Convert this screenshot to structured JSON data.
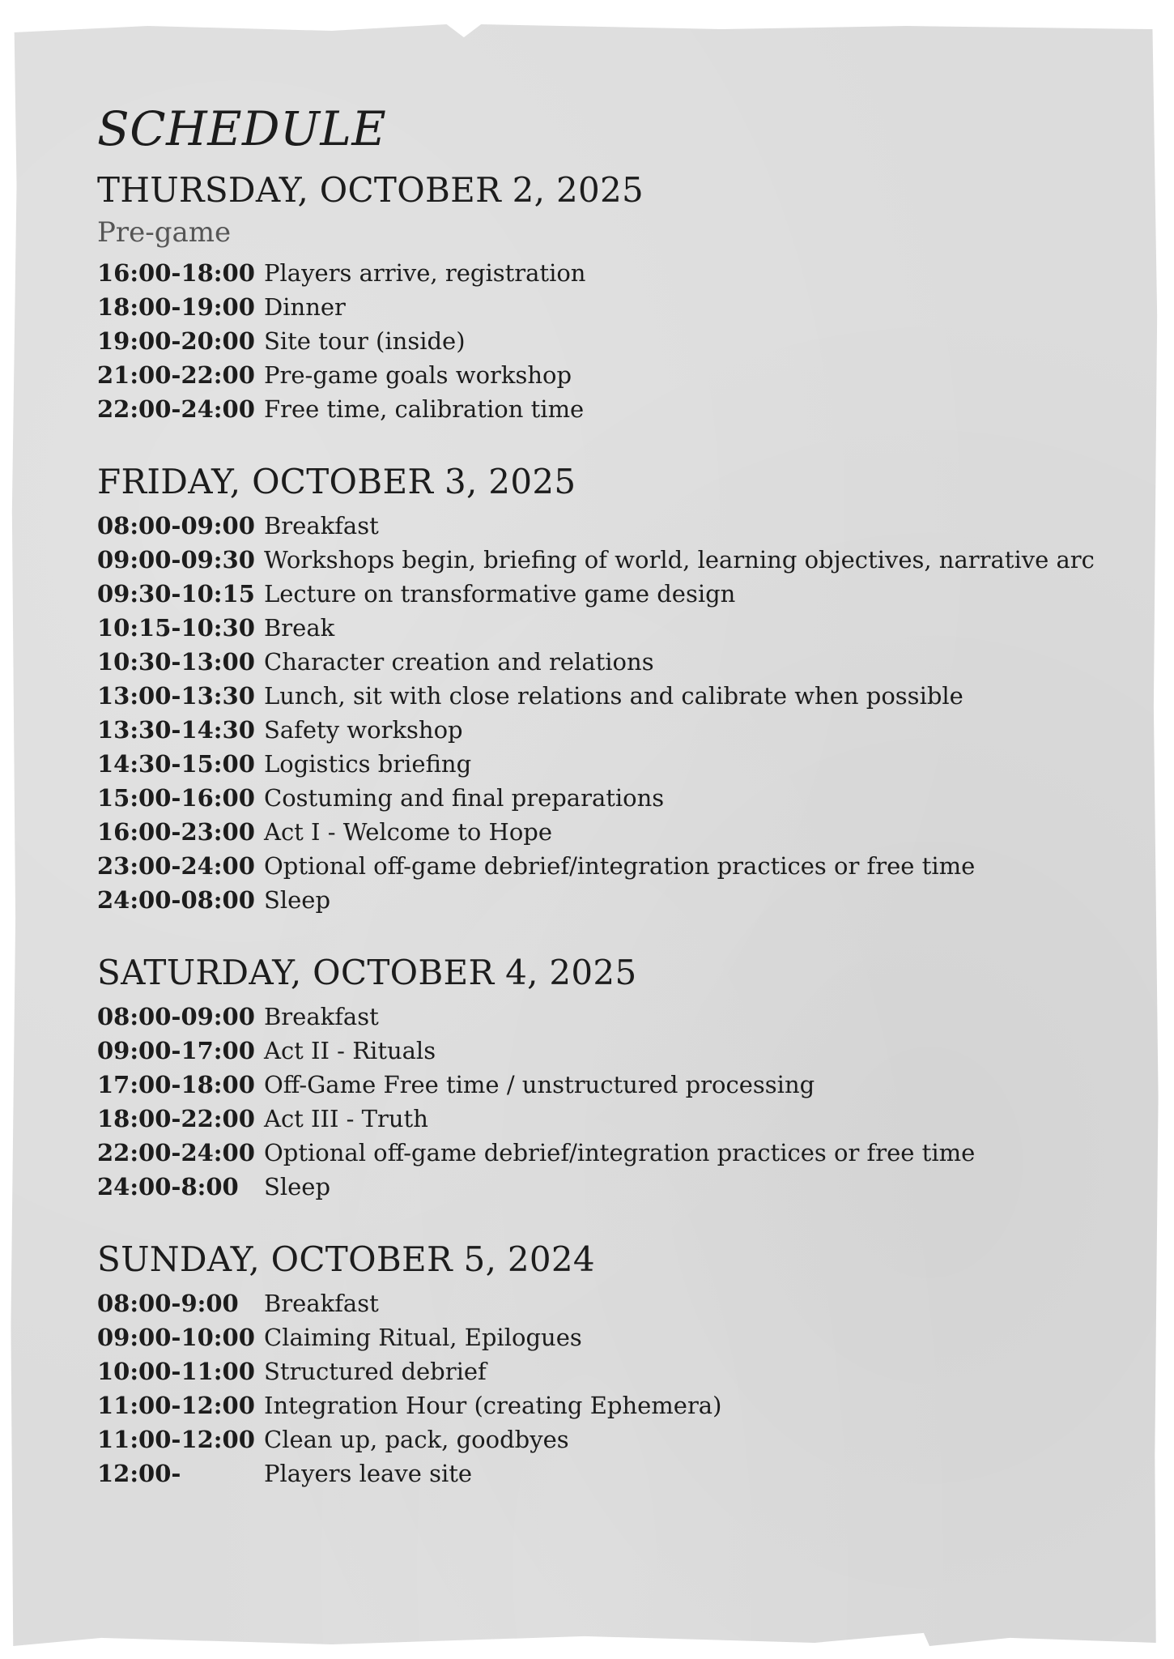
{
  "title": "SCHEDULE",
  "days": [
    {
      "heading": "THURSDAY, OCTOBER 2, 2025",
      "subtitle": "Pre-game",
      "rows": [
        {
          "time": "16:00-18:00",
          "activity": "Players arrive, registration"
        },
        {
          "time": "18:00-19:00",
          "activity": "Dinner"
        },
        {
          "time": "19:00-20:00",
          "activity": "Site tour (inside)"
        },
        {
          "time": "21:00-22:00",
          "activity": "Pre-game goals workshop"
        },
        {
          "time": "22:00-24:00",
          "activity": "Free time, calibration time"
        }
      ]
    },
    {
      "heading": "FRIDAY, OCTOBER 3, 2025",
      "rows": [
        {
          "time": "08:00-09:00",
          "activity": "Breakfast"
        },
        {
          "time": "09:00-09:30",
          "activity": "Workshops begin, briefing of world, learning objectives, narrative arc"
        },
        {
          "time": "09:30-10:15",
          "activity": "Lecture on transformative game design"
        },
        {
          "time": "10:15-10:30",
          "activity": "Break"
        },
        {
          "time": "10:30-13:00",
          "activity": "Character creation and relations"
        },
        {
          "time": "13:00-13:30",
          "activity": "Lunch, sit with close relations and calibrate when possible"
        },
        {
          "time": "13:30-14:30",
          "activity": "Safety workshop"
        },
        {
          "time": "14:30-15:00",
          "activity": "Logistics briefing"
        },
        {
          "time": "15:00-16:00",
          "activity": "Costuming and final preparations"
        },
        {
          "time": "16:00-23:00",
          "activity": "Act I - Welcome to Hope"
        },
        {
          "time": "23:00-24:00",
          "activity": "Optional off-game debrief/integration practices or free time"
        },
        {
          "time": "24:00-08:00",
          "activity": "Sleep"
        }
      ]
    },
    {
      "heading": "SATURDAY, OCTOBER 4, 2025",
      "rows": [
        {
          "time": "08:00-09:00",
          "activity": "Breakfast"
        },
        {
          "time": "09:00-17:00",
          "activity": "Act II - Rituals"
        },
        {
          "time": "17:00-18:00",
          "activity": "Off-Game Free time / unstructured processing"
        },
        {
          "time": "18:00-22:00",
          "activity": "Act III - Truth"
        },
        {
          "time": "22:00-24:00",
          "activity": "Optional off-game debrief/integration practices or free time"
        },
        {
          "time": "24:00-8:00",
          "activity": "Sleep"
        }
      ]
    },
    {
      "heading": "SUNDAY, OCTOBER 5, 2024",
      "rows": [
        {
          "time": "08:00-9:00",
          "activity": "Breakfast"
        },
        {
          "time": "09:00-10:00",
          "activity": "Claiming Ritual, Epilogues"
        },
        {
          "time": "10:00-11:00",
          "activity": "Structured debrief"
        },
        {
          "time": "11:00-12:00",
          "activity": "Integration Hour (creating Ephemera)"
        },
        {
          "time": "11:00-12:00",
          "activity": "Clean up, pack, goodbyes"
        },
        {
          "time": "12:00-",
          "activity": "Players leave site"
        }
      ]
    }
  ]
}
